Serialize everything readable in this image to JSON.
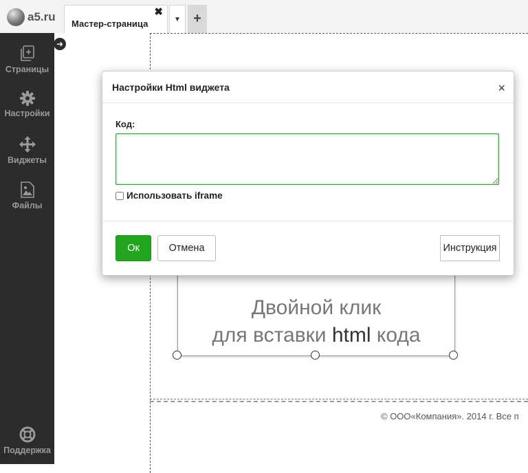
{
  "header": {
    "logo_text": "a5.ru",
    "tab_label": "Мастер-страница",
    "tab_close": "✖",
    "tab_dropdown": "▼",
    "tab_add": "+"
  },
  "sidebar": {
    "collapse_icon": "arrow-left-icon",
    "items": [
      {
        "label": "Страницы",
        "icon": "pages-icon"
      },
      {
        "label": "Настройки",
        "icon": "gear-icon"
      },
      {
        "label": "Виджеты",
        "icon": "move-icon"
      },
      {
        "label": "Файлы",
        "icon": "image-file-icon"
      }
    ],
    "support": {
      "label": "Поддержка",
      "icon": "lifebuoy-icon"
    }
  },
  "canvas": {
    "widget_line1": "Двойной клик",
    "widget_line2_prefix": "для вставки ",
    "widget_line2_strong": "html",
    "widget_line2_suffix": " кода",
    "footer": "© ООО«Компания». 2014 г. Все п"
  },
  "dialog": {
    "title": "Настройки Html виджета",
    "close": "×",
    "code_label": "Код:",
    "code_value": "",
    "iframe_label": "Использовать iframe",
    "iframe_checked": false,
    "ok_label": "Ок",
    "cancel_label": "Отмена",
    "help_label": "Инструкция"
  },
  "colors": {
    "sidebar_bg": "#2c2c2c",
    "ok_button": "#22a51f",
    "focus_border": "#3a9a3a"
  }
}
